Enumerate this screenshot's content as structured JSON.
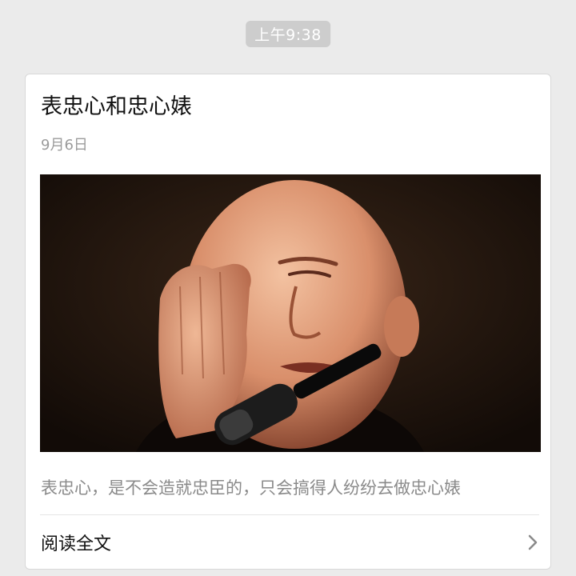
{
  "status": {
    "time": "上午9:38"
  },
  "article": {
    "title": "表忠心和忠心婊",
    "date": "9月6日",
    "cover_image_description": "man-covering-eye-at-microphone",
    "digest": "表忠心，是不会造就忠臣的，只会搞得人纷纷去做忠心婊",
    "read_more_label": "阅读全文",
    "read_more_icon": "chevron-right-icon"
  },
  "colors": {
    "background": "#ebebeb",
    "card": "#ffffff",
    "time_pill": "#cdcdcd",
    "muted_text": "#8a8a8a"
  }
}
